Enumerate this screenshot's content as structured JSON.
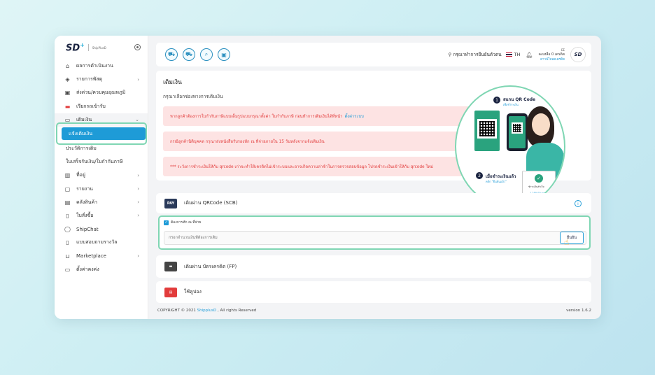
{
  "brand": {
    "logo": "SD",
    "logo_sup": "+",
    "logo_sub": "ShipPlusD"
  },
  "sidebar": {
    "items": [
      {
        "label": "ผลการดำเนินงาน",
        "icon": "home-icon"
      },
      {
        "label": "รายการพัสดุ",
        "icon": "box-icon",
        "chevron": "›"
      },
      {
        "label": "ส่งด่วน/ควบคุมอุณหภูมิ",
        "icon": "thermo-truck-icon"
      },
      {
        "label": "เรียกรถเข้ารับ",
        "icon": "truck-icon"
      },
      {
        "label": "เติมเงิน",
        "icon": "wallet-icon",
        "chevron": "⌄"
      },
      {
        "label": "แจ้งเติมเงิน",
        "icon": ""
      },
      {
        "label": "ประวัติการเติม",
        "icon": ""
      },
      {
        "label": "ใบเสร็จรับเงิน/ใบกำกับภาษี",
        "icon": ""
      },
      {
        "label": "ที่อยู่",
        "icon": "map-icon",
        "chevron": "›"
      },
      {
        "label": "รายงาน",
        "icon": "folder-icon",
        "chevron": "›"
      },
      {
        "label": "คลังสินค้า",
        "icon": "warehouse-icon",
        "chevron": "›"
      },
      {
        "label": "ใบสั่งซื้อ",
        "icon": "document-icon",
        "chevron": "›"
      },
      {
        "label": "ShipChat",
        "icon": "chat-icon"
      },
      {
        "label": "แบบสอบถามรางวัล",
        "icon": "survey-icon"
      },
      {
        "label": "Marketplace",
        "icon": "cart-icon",
        "chevron": "›"
      },
      {
        "label": "ตั้งค่าคงค่ง",
        "icon": "settings-icon"
      }
    ]
  },
  "topbar": {
    "verify_label": "กรุณาทำการยืนยันตัวตน",
    "language": "TH",
    "credit_top": "EE",
    "credit_label": "คงเหลือ 0 เครดิต",
    "credit_link": "ดาวน์โหลดเครดิต"
  },
  "main": {
    "title": "เติมเงิน",
    "subtitle": "กรุณาเลือกช่องทางการเติมเงิน",
    "alert1": "หากลูกค้าต้องการใบกำกับภาษีแบบเต็มรูปแบบกรุณาตั้งค่า ใบกำกับภาษี ก่อนทำการเติมเงินได้ที่หน้า",
    "alert1_link": "ตั้งค่าระบบ",
    "alert2": "กรณีลูกค้านิติบุคคล กรุณาส่งหนังสือรับรองหัก ณ ที่จ่ายภายใน 15 วันหลังจากแจ้งเติมเงิน",
    "alert3": "*** ระวังการชำระเงินให้กับ qrcode เก่าจะทำให้เครดิตไม่เข้าระบบและอาจเกิดความล่าช้าในการตรวจสอบข้อมูล โปรดชำระเงินเข้าให้กับ qrcode ใหม่"
  },
  "illustration": {
    "step1_num": "1",
    "step1_title": "สแกน QR Code",
    "step1_sub": "เพื่อชำระเงิน",
    "step2_num": "2",
    "step2_title": "เมื่อชำระเงินแล้ว",
    "step2_sub": "คลิก \"ยืนยันแล้ว\"",
    "card_amount": "1,250.00 บาท",
    "card_label": "ชำระเงินสำเร็จ",
    "confirm_label": "ยืนยันแล้ว"
  },
  "payments": {
    "qr_label": "เติมผ่าน QRCode (SCB)",
    "qr_icon": "PAY",
    "withholding_label": "ต้องการหัก ณ ที่จ่าย",
    "amount_placeholder": "กรอกจำนวนเงินที่ต้องการเติม",
    "confirm_button": "ยืนยัน",
    "card_label": "เติมผ่าน บัตรเครดิต (FP)",
    "coupon_label": "ใช้คูปอง"
  },
  "footer": {
    "copyright": "COPYRIGHT © 2021",
    "brand": "ShipplusD",
    "rights": ", All rights Reserved",
    "version": "version 1.6.2"
  },
  "colors": {
    "accent": "#1e9bd7",
    "highlight": "#7fd6b3",
    "alert_bg": "#fde3e3",
    "alert_text": "#e23c3c"
  }
}
